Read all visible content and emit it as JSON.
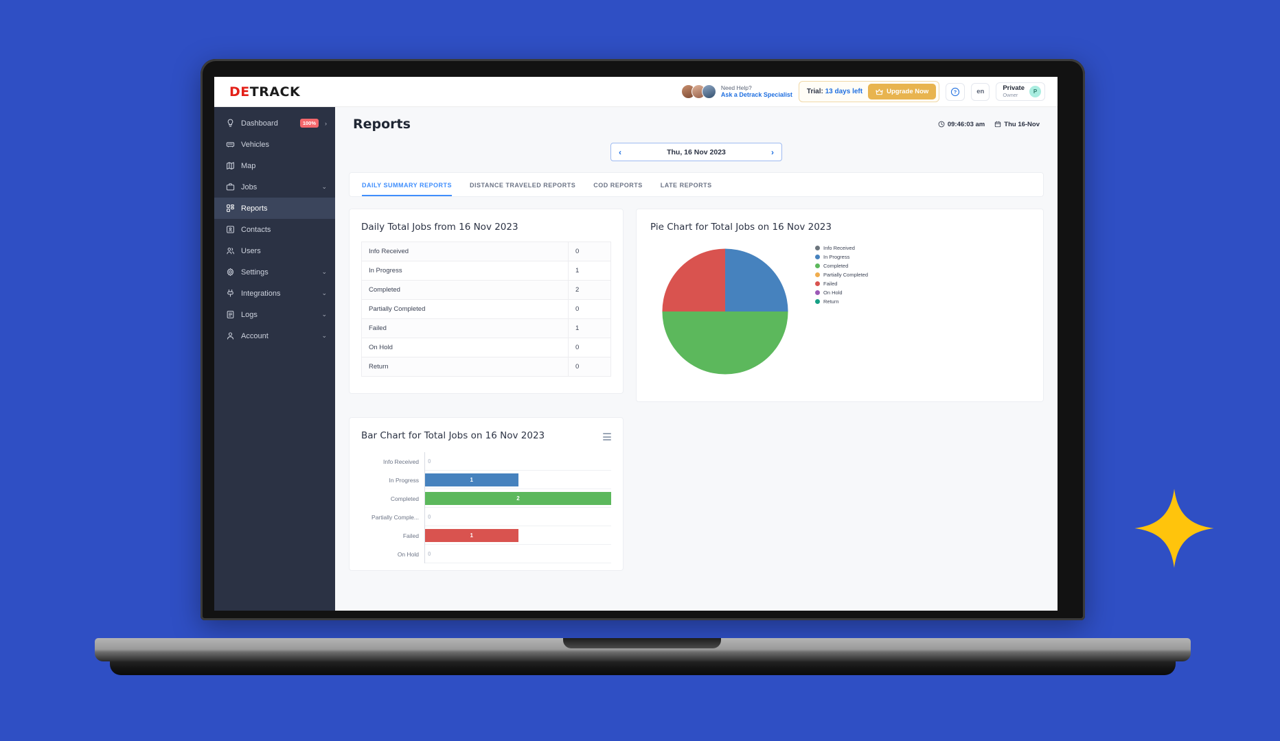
{
  "brand": {
    "logo_part1": "DE",
    "logo_part2": "TRACK"
  },
  "header": {
    "help_line1": "Need Help?",
    "help_line2": "Ask a Detrack Specialist",
    "trial_prefix": "Trial:",
    "trial_days": "13 days left",
    "upgrade_label": "Upgrade Now",
    "help_icon_label": "?",
    "language": "en",
    "account_name": "Private",
    "account_role": "Owner",
    "account_initial": "P"
  },
  "sidebar": {
    "items": [
      {
        "label": "Dashboard",
        "icon": "lightbulb-icon",
        "badge": "100%",
        "arrow": "›",
        "active": false
      },
      {
        "label": "Vehicles",
        "icon": "truck-icon",
        "badge": "",
        "arrow": "",
        "active": false
      },
      {
        "label": "Map",
        "icon": "map-icon",
        "badge": "",
        "arrow": "",
        "active": false
      },
      {
        "label": "Jobs",
        "icon": "briefcase-icon",
        "badge": "",
        "arrow": "⌄",
        "active": false
      },
      {
        "label": "Reports",
        "icon": "grid-icon",
        "badge": "",
        "arrow": "",
        "active": true
      },
      {
        "label": "Contacts",
        "icon": "contact-card-icon",
        "badge": "",
        "arrow": "",
        "active": false
      },
      {
        "label": "Users",
        "icon": "users-icon",
        "badge": "",
        "arrow": "",
        "active": false
      },
      {
        "label": "Settings",
        "icon": "gear-icon",
        "badge": "",
        "arrow": "⌄",
        "active": false
      },
      {
        "label": "Integrations",
        "icon": "plug-icon",
        "badge": "",
        "arrow": "⌄",
        "active": false
      },
      {
        "label": "Logs",
        "icon": "book-icon",
        "badge": "",
        "arrow": "⌄",
        "active": false
      },
      {
        "label": "Account",
        "icon": "person-icon",
        "badge": "",
        "arrow": "⌄",
        "active": false
      }
    ]
  },
  "page": {
    "title": "Reports",
    "time": "09:46:03 am",
    "date": "Thu 16-Nov",
    "datepicker_value": "Thu, 16 Nov 2023",
    "prev_arrow": "‹",
    "next_arrow": "›"
  },
  "tabs": [
    {
      "label": "DAILY SUMMARY REPORTS",
      "active": true
    },
    {
      "label": "DISTANCE TRAVELED REPORTS",
      "active": false
    },
    {
      "label": "COD REPORTS",
      "active": false
    },
    {
      "label": "LATE REPORTS",
      "active": false
    }
  ],
  "colors": {
    "info_received": "#6c757d",
    "in_progress": "#4682be",
    "completed": "#5cb85c",
    "partially_completed": "#f0ad4e",
    "failed": "#d9534f",
    "on_hold": "#9b59b6",
    "return": "#16a085",
    "accent_blue": "#3f8efc",
    "background": "#2f4fc4",
    "sparkle": "#ffc40c",
    "upgrade": "#e8b44f"
  },
  "chart_data": [
    {
      "type": "table",
      "title": "Daily Total Jobs from 16 Nov 2023",
      "categories": [
        "Info Received",
        "In Progress",
        "Completed",
        "Partially Completed",
        "Failed",
        "On Hold",
        "Return"
      ],
      "values": [
        0,
        1,
        2,
        0,
        1,
        0,
        0
      ]
    },
    {
      "type": "pie",
      "title": "Pie Chart for Total Jobs on 16 Nov 2023",
      "categories": [
        "Info Received",
        "In Progress",
        "Completed",
        "Partially Completed",
        "Failed",
        "On Hold",
        "Return"
      ],
      "values": [
        0,
        1,
        2,
        0,
        1,
        0,
        0
      ],
      "percentages": [
        0,
        25,
        50,
        0,
        25,
        0,
        0
      ],
      "colors": [
        "#6c757d",
        "#4682be",
        "#5cb85c",
        "#f0ad4e",
        "#d9534f",
        "#9b59b6",
        "#16a085"
      ],
      "legend_position": "right",
      "total": 4
    },
    {
      "type": "bar",
      "orientation": "horizontal",
      "title": "Bar Chart for Total Jobs on 16 Nov 2023",
      "categories": [
        "Info Received",
        "In Progress",
        "Completed",
        "Partially Comple...",
        "Failed",
        "On Hold"
      ],
      "values": [
        0,
        1,
        2,
        0,
        1,
        0
      ],
      "colors": [
        "#6c757d",
        "#4682be",
        "#5cb85c",
        "#f0ad4e",
        "#d9534f",
        "#9b59b6"
      ],
      "xlabel": "",
      "ylabel": "",
      "xlim": [
        0,
        2
      ],
      "grid": true,
      "menu_icon": "hamburger-menu-icon"
    }
  ]
}
